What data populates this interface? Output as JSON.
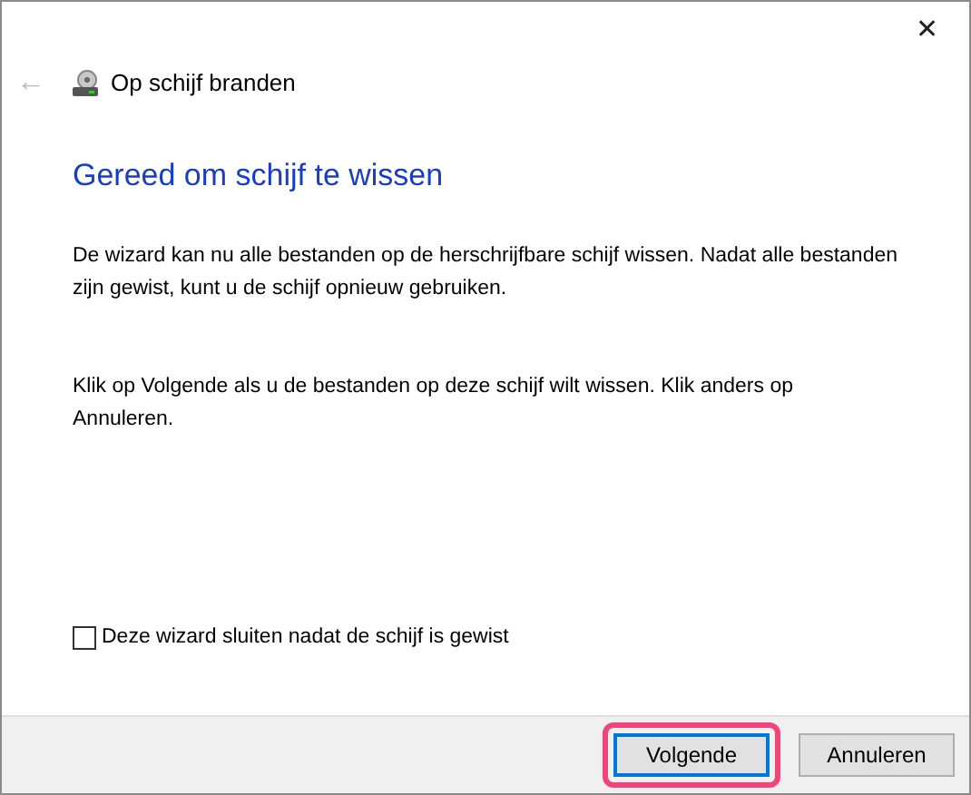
{
  "window": {
    "close": "✕"
  },
  "header": {
    "back": "←",
    "title": "Op schijf branden",
    "back_disabled": true
  },
  "heading": "Gereed om schijf te wissen",
  "paragraphs": [
    "De wizard kan nu alle bestanden op de herschrijfbare schijf wissen. Nadat alle bestanden zijn gewist, kunt u de schijf opnieuw gebruiken.",
    "Klik op Volgende als u de bestanden op deze schijf wilt wissen. Klik anders op Annuleren."
  ],
  "checkbox": {
    "label": "Deze wizard sluiten nadat de schijf is gewist",
    "checked": false
  },
  "buttons": [
    {
      "label": "Volgende",
      "default": true,
      "highlighted": true
    },
    {
      "label": "Annuleren",
      "default": false,
      "highlighted": false
    }
  ]
}
